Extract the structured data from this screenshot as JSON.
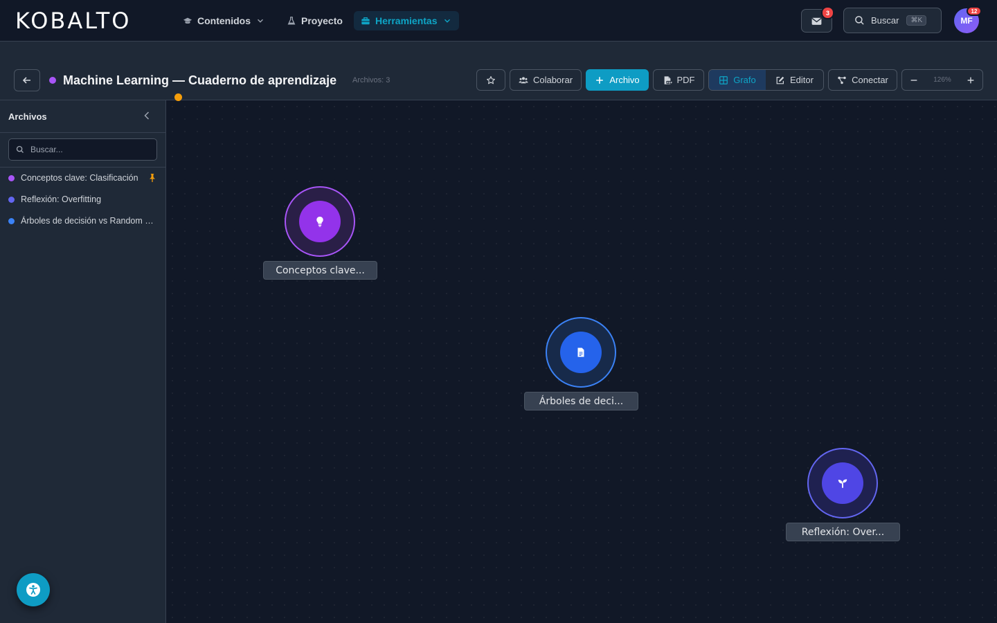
{
  "nav": {
    "logo": "KOBALTO",
    "items": [
      {
        "label": "Contenidos"
      },
      {
        "label": "Proyecto"
      },
      {
        "label": "Herramientas"
      }
    ],
    "mail_badge": "3",
    "search_label": "Buscar",
    "search_shortcut": "⌘K",
    "avatar_initials": "MF",
    "avatar_badge": "12"
  },
  "header": {
    "title": "Machine Learning — Cuaderno de aprendizaje",
    "file_count": "Archivos: 3",
    "buttons": {
      "collaborate": "Colaborar",
      "add_file": "Archivo",
      "pdf": "PDF",
      "graph": "Grafo",
      "editor": "Editor",
      "connect": "Conectar"
    },
    "zoom": "126%"
  },
  "sidebar": {
    "title": "Archivos",
    "search_placeholder": "Buscar...",
    "items": [
      {
        "label": "Conceptos clave: Clasificación",
        "color": "#a855f7",
        "pinned": true
      },
      {
        "label": "Reflexión: Overfitting",
        "color": "#6366f1",
        "pinned": false
      },
      {
        "label": "Árboles de decisión vs Random Forest",
        "color": "#3b82f6",
        "pinned": false
      }
    ]
  },
  "graph": {
    "nodes": [
      {
        "label": "Conceptos clave...",
        "icon": "lightbulb-icon",
        "color": "#a855f7",
        "flagged": true
      },
      {
        "label": "Árboles de deci...",
        "icon": "document-icon",
        "color": "#3b82f6",
        "flagged": false
      },
      {
        "label": "Reflexión: Over...",
        "icon": "sprout-icon",
        "color": "#6366f1",
        "flagged": false
      }
    ]
  },
  "colors": {
    "accent": "#0e9cc4",
    "background": "#111827",
    "panel": "#1f2937",
    "flag": "#f59e0b"
  }
}
